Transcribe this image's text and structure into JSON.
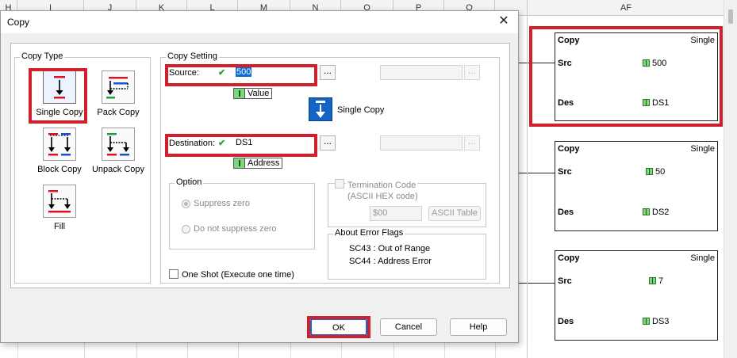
{
  "spreadsheet": {
    "columns": [
      "H",
      "I",
      "J",
      "K",
      "L",
      "M",
      "N",
      "O",
      "P",
      "Q"
    ],
    "right_column": "AF"
  },
  "dialog": {
    "title": "Copy",
    "copy_type": {
      "legend": "Copy Type",
      "tools": [
        {
          "label": "Single Copy",
          "selected": true
        },
        {
          "label": "Pack Copy",
          "selected": false
        },
        {
          "label": "Block Copy",
          "selected": false
        },
        {
          "label": "Unpack Copy",
          "selected": false
        },
        {
          "label": "Fill",
          "selected": false
        }
      ]
    },
    "copy_setting": {
      "legend": "Copy Setting",
      "source": {
        "label": "Source:",
        "value": "500",
        "type_tag": "Value"
      },
      "destination": {
        "label": "Destination:",
        "value": "DS1",
        "type_tag": "Address"
      },
      "mode_label": "Single Copy",
      "browse_label": "..."
    },
    "option": {
      "legend": "Option",
      "items": [
        "Suppress zero",
        "Do not suppress zero"
      ]
    },
    "termination": {
      "label": "Termination Code",
      "sub_label": "(ASCII HEX code)",
      "value": "$00",
      "button": "ASCII Table"
    },
    "error_flags": {
      "legend": "About Error Flags",
      "lines": [
        "SC43 : Out of Range",
        "SC44 : Address Error"
      ]
    },
    "one_shot": "One Shot (Execute one time)",
    "buttons": {
      "ok": "OK",
      "cancel": "Cancel",
      "help": "Help"
    }
  },
  "ladder_blocks": [
    {
      "name": "Copy",
      "mode": "Single",
      "src_label": "Src",
      "src": "500",
      "des_label": "Des",
      "des": "DS1"
    },
    {
      "name": "Copy",
      "mode": "Single",
      "src_label": "Src",
      "src": "50",
      "des_label": "Des",
      "des": "DS2"
    },
    {
      "name": "Copy",
      "mode": "Single",
      "src_label": "Src",
      "src": "7",
      "des_label": "Des",
      "des": "DS3"
    }
  ],
  "colors": {
    "highlight": "#d0202e",
    "accent": "#0a6cd6",
    "value_tag": "#7ed67e"
  }
}
